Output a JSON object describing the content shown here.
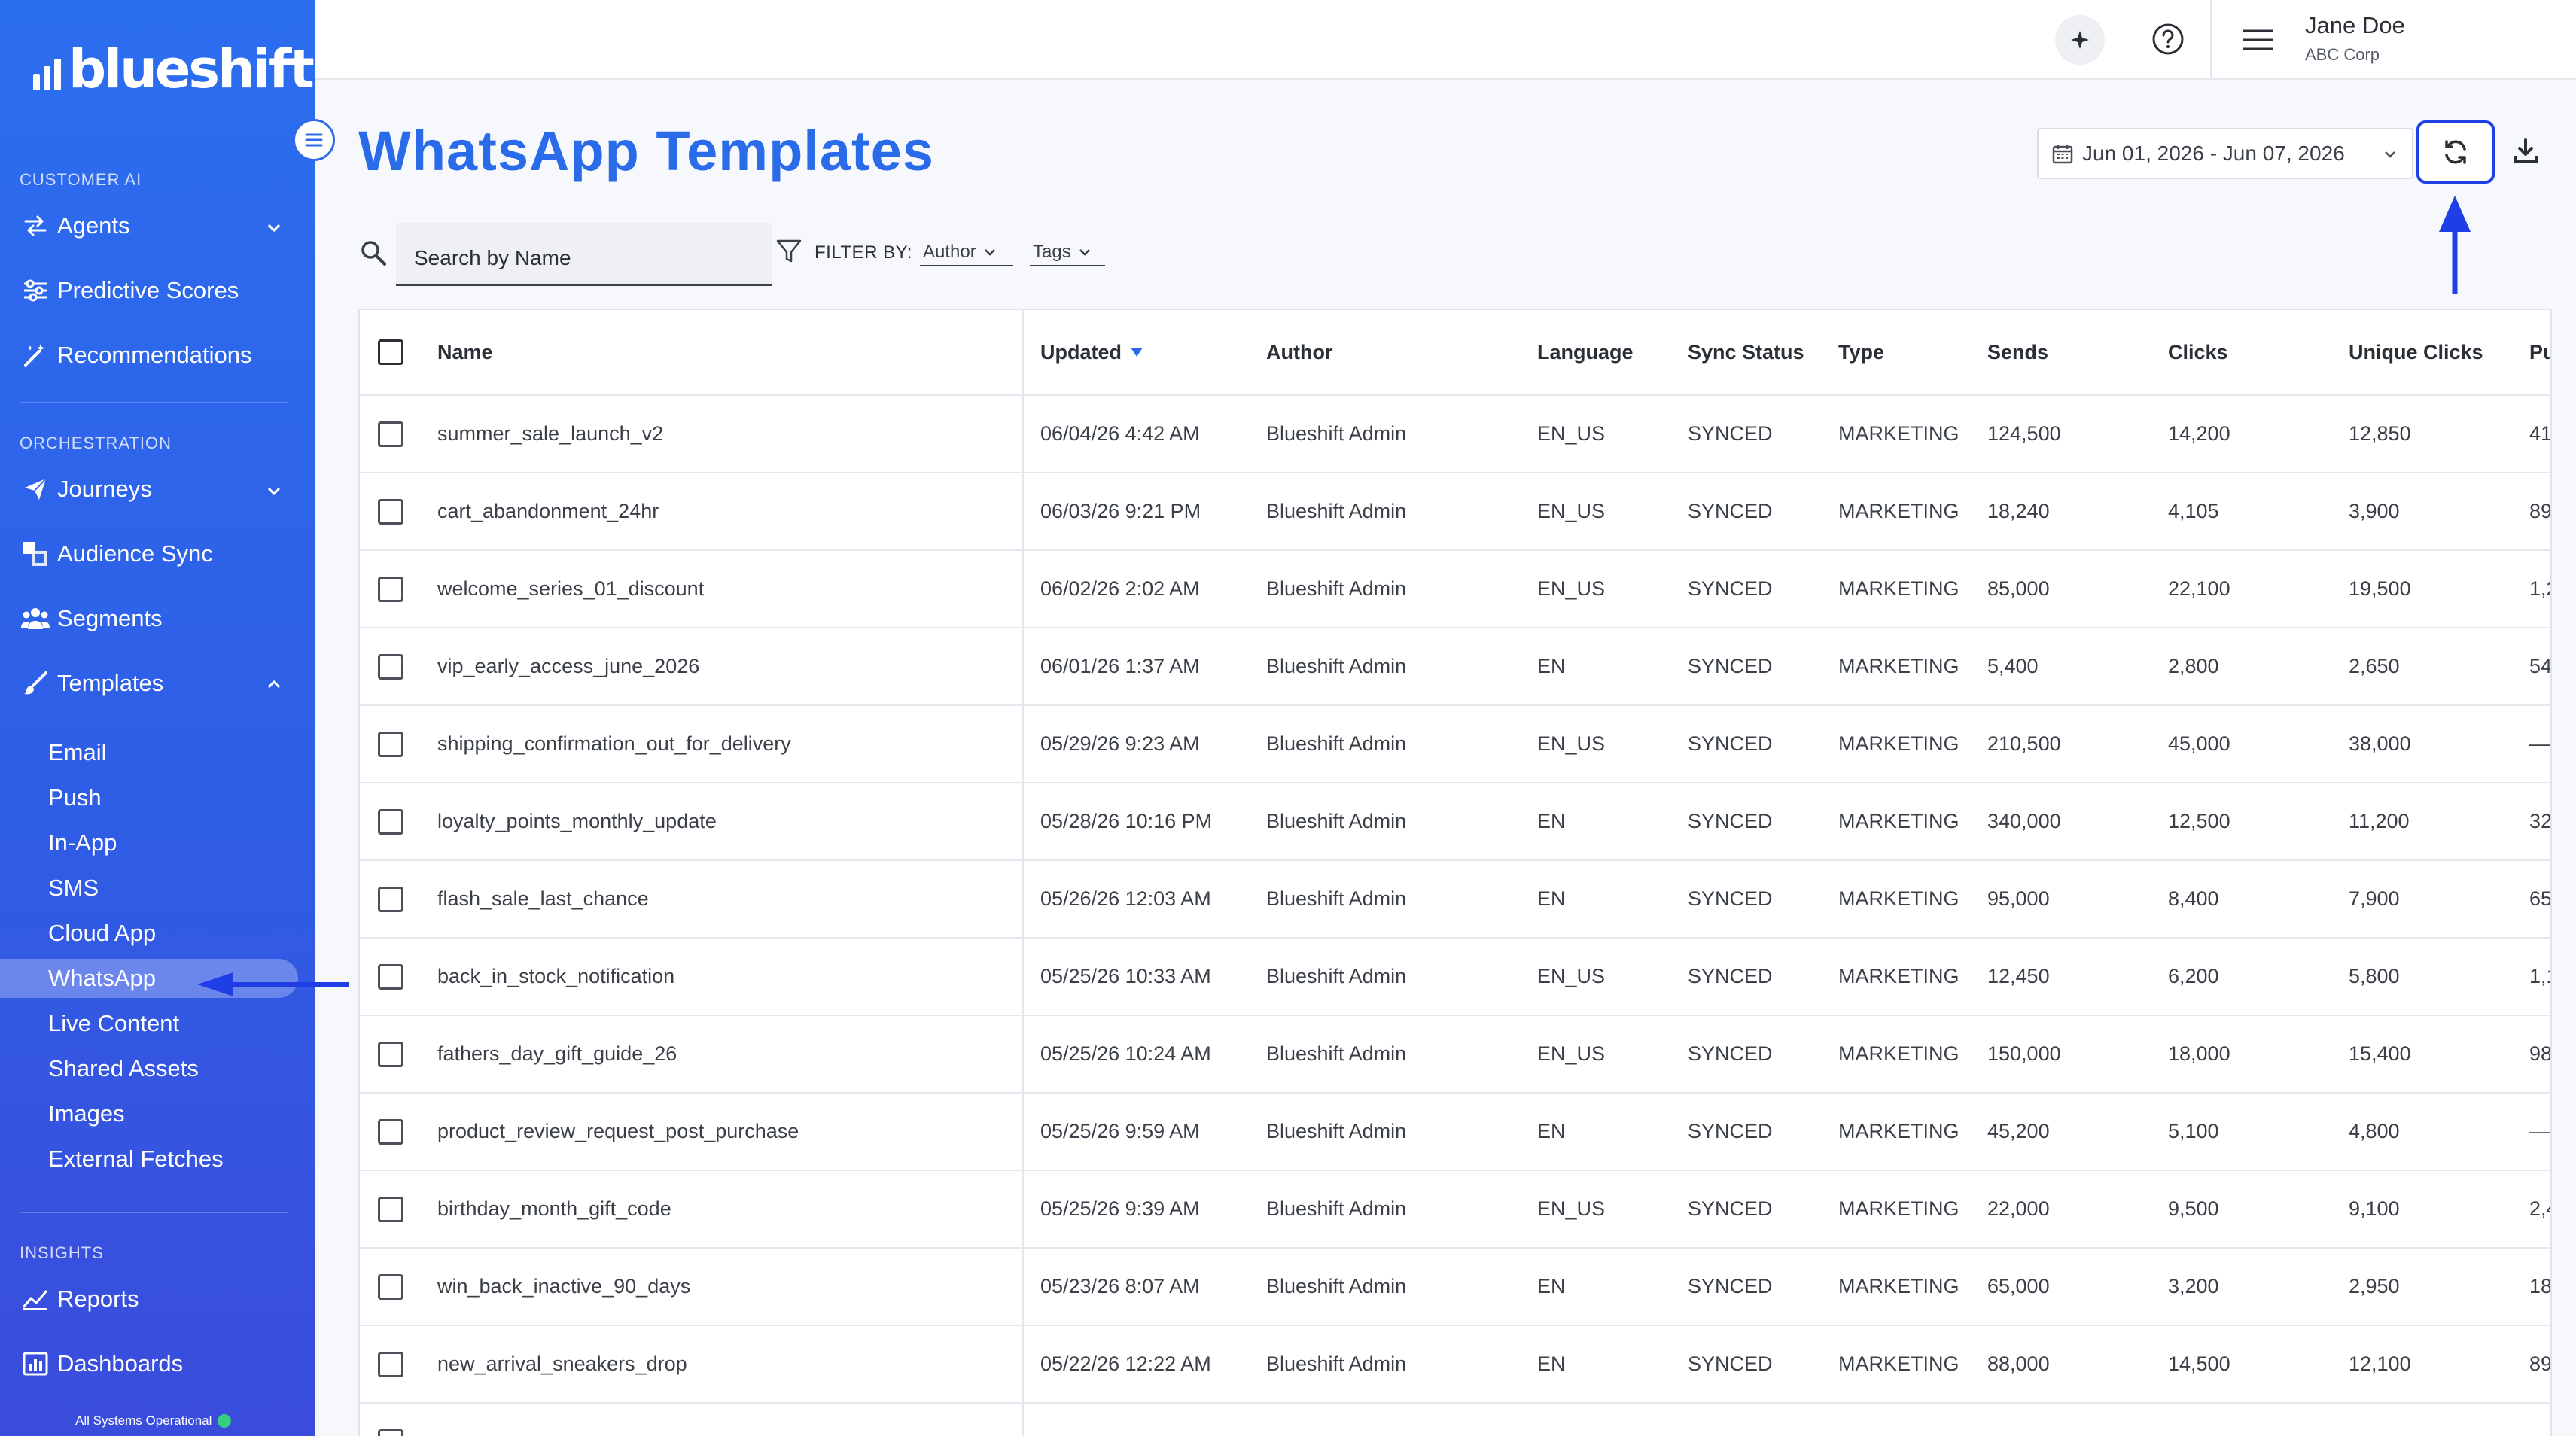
{
  "brand": {
    "logo_text": "blueshift"
  },
  "sidebar": {
    "sections": [
      {
        "label": "CUSTOMER AI"
      },
      {
        "label": "ORCHESTRATION"
      },
      {
        "label": "INSIGHTS"
      }
    ],
    "customer_ai": [
      {
        "label": "Agents"
      },
      {
        "label": "Predictive Scores"
      },
      {
        "label": "Recommendations"
      }
    ],
    "orchestration": [
      {
        "label": "Journeys"
      },
      {
        "label": "Audience Sync"
      },
      {
        "label": "Segments"
      },
      {
        "label": "Templates"
      }
    ],
    "templates_sub": [
      {
        "label": "Email"
      },
      {
        "label": "Push"
      },
      {
        "label": "In-App"
      },
      {
        "label": "SMS"
      },
      {
        "label": "Cloud App"
      },
      {
        "label": "WhatsApp"
      },
      {
        "label": "Live Content"
      },
      {
        "label": "Shared Assets"
      },
      {
        "label": "Images"
      },
      {
        "label": "External Fetches"
      }
    ],
    "insights": [
      {
        "label": "Reports"
      },
      {
        "label": "Dashboards"
      }
    ],
    "status_text": "All Systems Operational",
    "status_color": "#35d07f"
  },
  "topbar": {
    "user_name": "Jane Doe",
    "user_org": "ABC Corp"
  },
  "page": {
    "title": "WhatsApp Templates",
    "date_range": "Jun 01, 2026 - Jun 07, 2026",
    "search_placeholder": "Search by Name",
    "filter_label": "FILTER BY:",
    "filter_author": "Author",
    "filter_tags": "Tags"
  },
  "table": {
    "columns": [
      "Name",
      "Updated",
      "Author",
      "Language",
      "Sync Status",
      "Type",
      "Sends",
      "Clicks",
      "Unique Clicks",
      "Pu"
    ],
    "rows": [
      [
        "summer_sale_launch_v2",
        "06/04/26 4:42 AM",
        "Blueshift Admin",
        "EN_US",
        "SYNCED",
        "MARKETING",
        "124,500",
        "14,200",
        "12,850",
        "41"
      ],
      [
        "cart_abandonment_24hr",
        "06/03/26 9:21 PM",
        "Blueshift Admin",
        "EN_US",
        "SYNCED",
        "MARKETING",
        "18,240",
        "4,105",
        "3,900",
        "89"
      ],
      [
        "welcome_series_01_discount",
        "06/02/26 2:02 AM",
        "Blueshift Admin",
        "EN_US",
        "SYNCED",
        "MARKETING",
        "85,000",
        "22,100",
        "19,500",
        "1,2"
      ],
      [
        "vip_early_access_june_2026",
        "06/01/26 1:37 AM",
        "Blueshift Admin",
        "EN",
        "SYNCED",
        "MARKETING",
        "5,400",
        "2,800",
        "2,650",
        "54"
      ],
      [
        "shipping_confirmation_out_for_delivery",
        "05/29/26 9:23 AM",
        "Blueshift Admin",
        "EN_US",
        "SYNCED",
        "MARKETING",
        "210,500",
        "45,000",
        "38,000",
        "—"
      ],
      [
        "loyalty_points_monthly_update",
        "05/28/26 10:16 PM",
        "Blueshift Admin",
        "EN",
        "SYNCED",
        "MARKETING",
        "340,000",
        "12,500",
        "11,200",
        "32"
      ],
      [
        "flash_sale_last_chance",
        "05/26/26 12:03 AM",
        "Blueshift Admin",
        "EN",
        "SYNCED",
        "MARKETING",
        "95,000",
        "8,400",
        "7,900",
        "65"
      ],
      [
        "back_in_stock_notification",
        "05/25/26 10:33 AM",
        "Blueshift Admin",
        "EN_US",
        "SYNCED",
        "MARKETING",
        "12,450",
        "6,200",
        "5,800",
        "1,1"
      ],
      [
        "fathers_day_gift_guide_26",
        "05/25/26 10:24 AM",
        "Blueshift Admin",
        "EN_US",
        "SYNCED",
        "MARKETING",
        "150,000",
        "18,000",
        "15,400",
        "98"
      ],
      [
        "product_review_request_post_purchase",
        "05/25/26 9:59 AM",
        "Blueshift Admin",
        "EN",
        "SYNCED",
        "MARKETING",
        "45,200",
        "5,100",
        "4,800",
        "—"
      ],
      [
        "birthday_month_gift_code",
        "05/25/26 9:39 AM",
        "Blueshift Admin",
        "EN_US",
        "SYNCED",
        "MARKETING",
        "22,000",
        "9,500",
        "9,100",
        "2,4"
      ],
      [
        "win_back_inactive_90_days",
        "05/23/26 8:07 AM",
        "Blueshift Admin",
        "EN",
        "SYNCED",
        "MARKETING",
        "65,000",
        "3,200",
        "2,950",
        "18"
      ],
      [
        "new_arrival_sneakers_drop",
        "05/22/26 12:22 AM",
        "Blueshift Admin",
        "EN",
        "SYNCED",
        "MARKETING",
        "88,000",
        "14,500",
        "12,100",
        "89"
      ]
    ]
  },
  "colors": {
    "accent": "#2a6be9",
    "annotation": "#1f3ee6"
  }
}
